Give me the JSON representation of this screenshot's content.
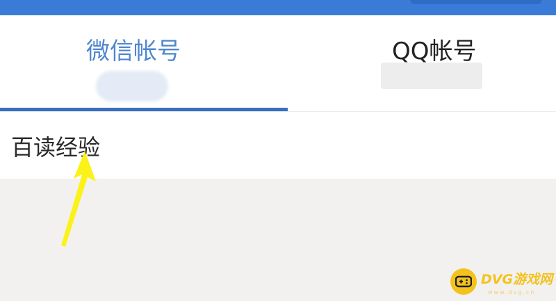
{
  "tabs": [
    {
      "label": "微信帐号",
      "active": true
    },
    {
      "label": "QQ帐号",
      "active": false
    }
  ],
  "list": {
    "items": [
      {
        "label": "百读经验"
      }
    ]
  },
  "colors": {
    "header": "#3b7bd8",
    "active_tab": "#4e86cf",
    "underline": "#3a6fc2",
    "annotation_arrow": "#fbf21a",
    "watermark": "#f4c21c"
  },
  "watermark": {
    "text": "DVG游戏网",
    "url": "www.dvg.cn",
    "icon": "gamepad-icon"
  }
}
